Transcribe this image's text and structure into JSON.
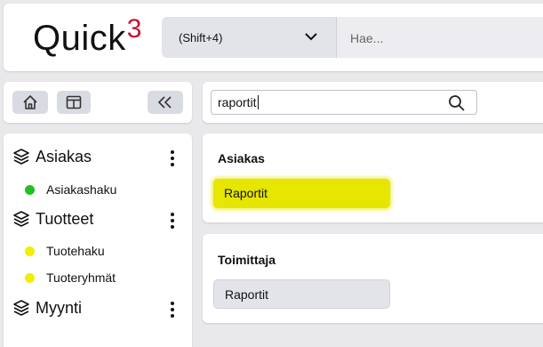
{
  "header": {
    "logo_text": "Quick",
    "logo_sup": "3",
    "shortcut_value": "(Shift+4)",
    "search_placeholder": "Hae..."
  },
  "search": {
    "value": "raportit"
  },
  "sidebar": {
    "groups": [
      {
        "title": "Asiakas",
        "items": [
          {
            "label": "Asiakashaku",
            "status_color": "#20c020"
          }
        ]
      },
      {
        "title": "Tuotteet",
        "items": [
          {
            "label": "Tuotehaku",
            "status_color": "#f2ee00"
          },
          {
            "label": "Tuoteryhmät",
            "status_color": "#f2ee00"
          }
        ]
      },
      {
        "title": "Myynti",
        "items": []
      }
    ]
  },
  "results": [
    {
      "title": "Asiakas",
      "button": "Raportit",
      "highlighted": true,
      "highlight_color": "#e6e600"
    },
    {
      "title": "Toimittaja",
      "button": "Raportit",
      "highlighted": false,
      "button_color": "#e3e3ea"
    }
  ],
  "colors": {
    "brand_accent": "#c8102e",
    "background": "#e9e9ec"
  }
}
